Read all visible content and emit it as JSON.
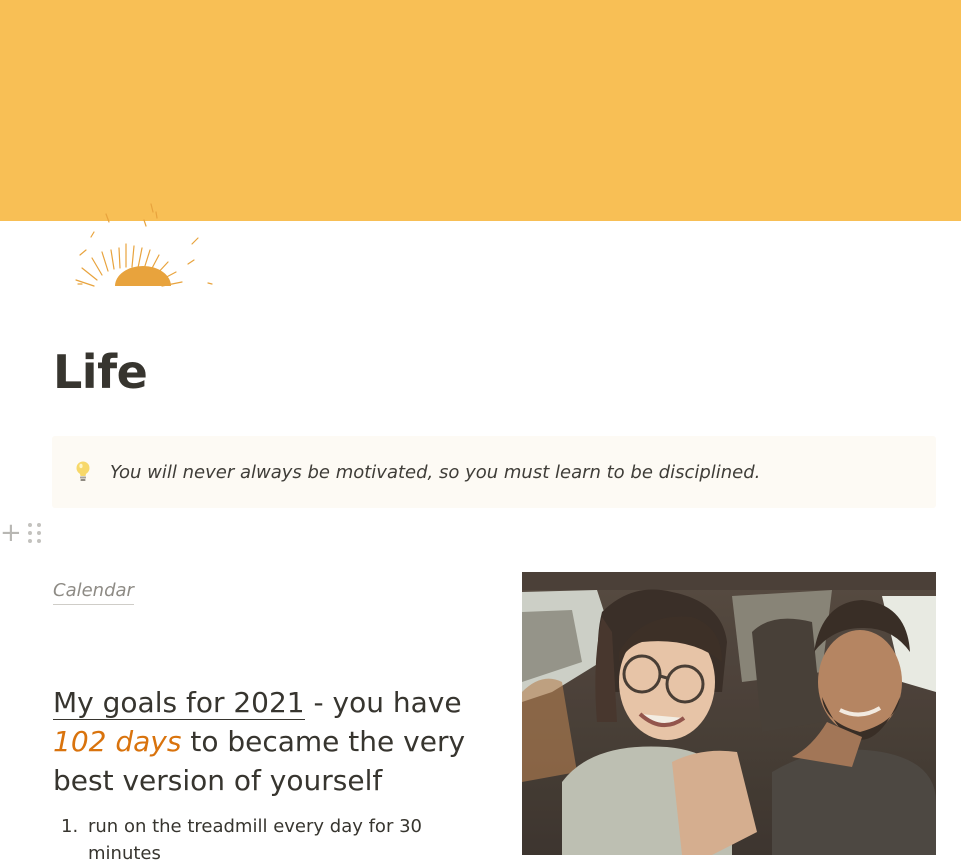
{
  "cover": {
    "color": "#f8bf55"
  },
  "page_icon": {
    "icon": "sunrise-icon",
    "color": "#e8a33d"
  },
  "title": "Life",
  "callout": {
    "icon": "lightbulb-icon",
    "text": "You will never always be motivated, so you must learn to be disciplined."
  },
  "block_controls": {
    "add_icon": "plus-icon",
    "drag_icon": "drag-handle-icon"
  },
  "calendar_link": "Calendar",
  "goals": {
    "heading_link": "My goals for 2021",
    "heading_mid": " - you have ",
    "days": "102 days",
    "heading_end": " to became the very best version of yourself",
    "days_color": "#d9730d",
    "items": [
      {
        "number": "1.",
        "text": "run on the treadmill every day for 30 minutes"
      }
    ]
  },
  "photo": {
    "description_icon": "couple-photo"
  }
}
